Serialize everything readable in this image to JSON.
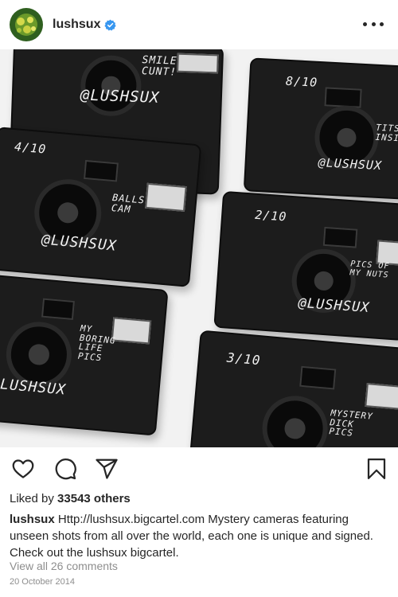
{
  "post": {
    "username": "lushsux",
    "verified": true,
    "likes_prefix": "Liked by",
    "likes_count": "33543 others",
    "caption_user": "lushsux",
    "caption_text": "Http://lushsux.bigcartel.com Mystery cameras featuring unseen shots from all over the world, each one is unique and signed. Check out the lushsux bigcartel.",
    "comments_link": "View all 26 comments",
    "date": "20 October 2014"
  },
  "photo": {
    "cameras": [
      {
        "text": "SMILE\nCUNT!",
        "tag": "@LUSHSUX",
        "count": ""
      },
      {
        "text": "TITS\nINSIDE",
        "tag": "@LUSHSUX",
        "count": "8/10"
      },
      {
        "text": "BALLS\nCAM",
        "tag": "@LUSHSUX",
        "count": "4/10"
      },
      {
        "text": "PICS OF\nMY NUTS",
        "tag": "@LUSHSUX",
        "count": "2/10"
      },
      {
        "text": "MY\nBORING\nLIFE\nPICS",
        "tag": "@LUSHSUX",
        "count": ""
      },
      {
        "text": "MYSTERY\nDICK\nPICS",
        "tag": "",
        "count": "3/10"
      }
    ]
  },
  "icons": {
    "more": "more-options-icon",
    "verified": "verified-badge-icon",
    "like": "heart-icon",
    "comment": "comment-icon",
    "share": "share-icon",
    "save": "bookmark-icon"
  },
  "colors": {
    "verified_blue": "#3897f0",
    "text_primary": "#262626",
    "text_secondary": "#8e8e8e"
  }
}
